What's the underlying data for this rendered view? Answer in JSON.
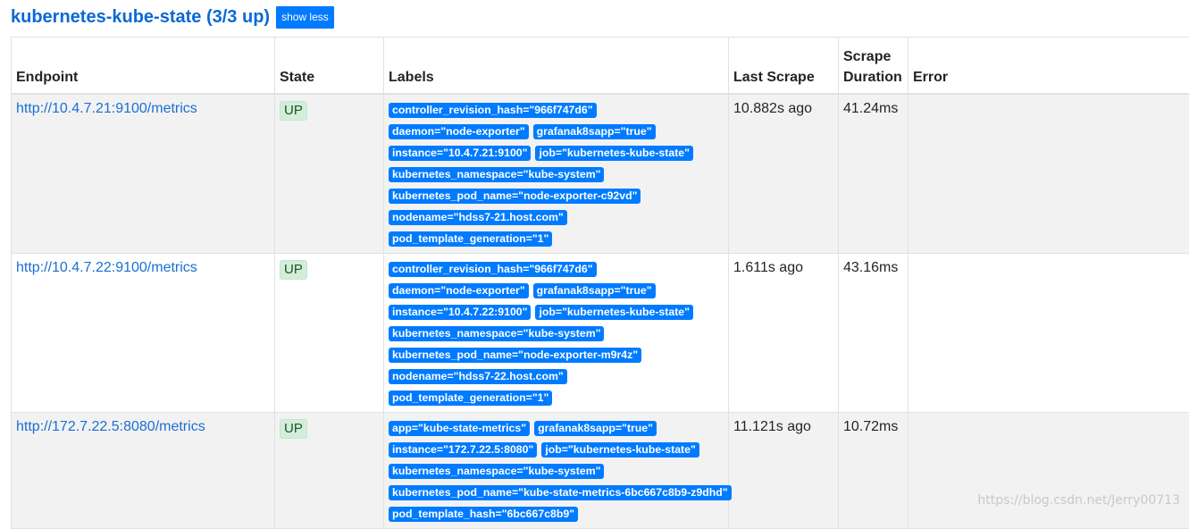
{
  "job": {
    "title": "kubernetes-kube-state (3/3 up)",
    "toggle_label": "show less"
  },
  "columns": [
    "Endpoint",
    "State",
    "Labels",
    "Last Scrape",
    "Scrape\nDuration",
    "Error"
  ],
  "targets": [
    {
      "endpoint": "http://10.4.7.21:9100/metrics",
      "state": "UP",
      "labels": [
        "controller_revision_hash=\"966f747d6\"",
        "daemon=\"node-exporter\"",
        "grafanak8sapp=\"true\"",
        "instance=\"10.4.7.21:9100\"",
        "job=\"kubernetes-kube-state\"",
        "kubernetes_namespace=\"kube-system\"",
        "kubernetes_pod_name=\"node-exporter-c92vd\"",
        "nodename=\"hdss7-21.host.com\"",
        "pod_template_generation=\"1\""
      ],
      "last_scrape": "10.882s ago",
      "scrape_duration": "41.24ms",
      "error": ""
    },
    {
      "endpoint": "http://10.4.7.22:9100/metrics",
      "state": "UP",
      "labels": [
        "controller_revision_hash=\"966f747d6\"",
        "daemon=\"node-exporter\"",
        "grafanak8sapp=\"true\"",
        "instance=\"10.4.7.22:9100\"",
        "job=\"kubernetes-kube-state\"",
        "kubernetes_namespace=\"kube-system\"",
        "kubernetes_pod_name=\"node-exporter-m9r4z\"",
        "nodename=\"hdss7-22.host.com\"",
        "pod_template_generation=\"1\""
      ],
      "last_scrape": "1.611s ago",
      "scrape_duration": "43.16ms",
      "error": ""
    },
    {
      "endpoint": "http://172.7.22.5:8080/metrics",
      "state": "UP",
      "labels": [
        "app=\"kube-state-metrics\"",
        "grafanak8sapp=\"true\"",
        "instance=\"172.7.22.5:8080\"",
        "job=\"kubernetes-kube-state\"",
        "kubernetes_namespace=\"kube-system\"",
        "kubernetes_pod_name=\"kube-state-metrics-6bc667c8b9-z9dhd\"",
        "pod_template_hash=\"6bc667c8b9\""
      ],
      "last_scrape": "11.121s ago",
      "scrape_duration": "10.72ms",
      "error": ""
    }
  ],
  "watermark": "https://blog.csdn.net/Jerry00713",
  "colors": {
    "accent": "#007bff",
    "up_bg": "#d4edda",
    "up_text": "#155724",
    "row_stripe": "#f2f2f2"
  }
}
